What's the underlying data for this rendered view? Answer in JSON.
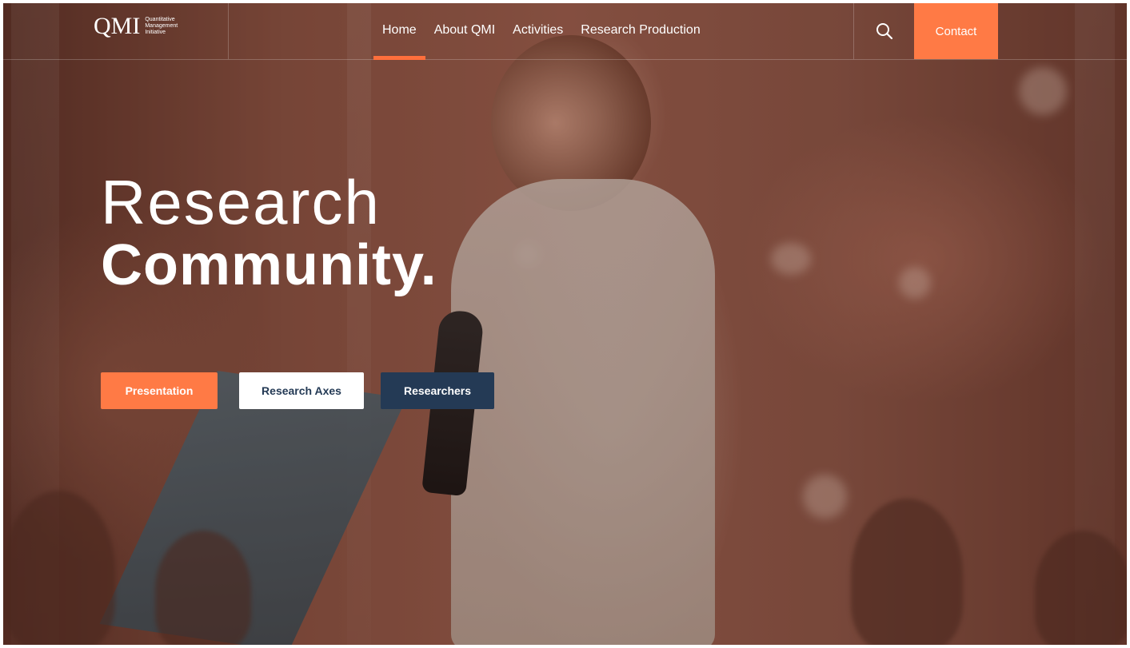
{
  "brand": {
    "logo_mark": "QMI",
    "logo_line1": "Quantitative",
    "logo_line2": "Management",
    "logo_line3": "Initiative"
  },
  "nav": {
    "items": [
      {
        "label": "Home",
        "active": true
      },
      {
        "label": "About QMI",
        "active": false
      },
      {
        "label": "Activities",
        "active": false
      },
      {
        "label": "Research Production",
        "active": false
      }
    ]
  },
  "header": {
    "search_icon": "search-icon",
    "contact_label": "Contact"
  },
  "hero": {
    "title_light": "Research",
    "title_bold": "Community.",
    "buttons": [
      {
        "label": "Presentation",
        "style": "orange"
      },
      {
        "label": "Research Axes",
        "style": "white"
      },
      {
        "label": "Researchers",
        "style": "navy"
      }
    ]
  },
  "colors": {
    "accent": "#ff7a45",
    "navy": "#243a55",
    "white": "#ffffff"
  }
}
